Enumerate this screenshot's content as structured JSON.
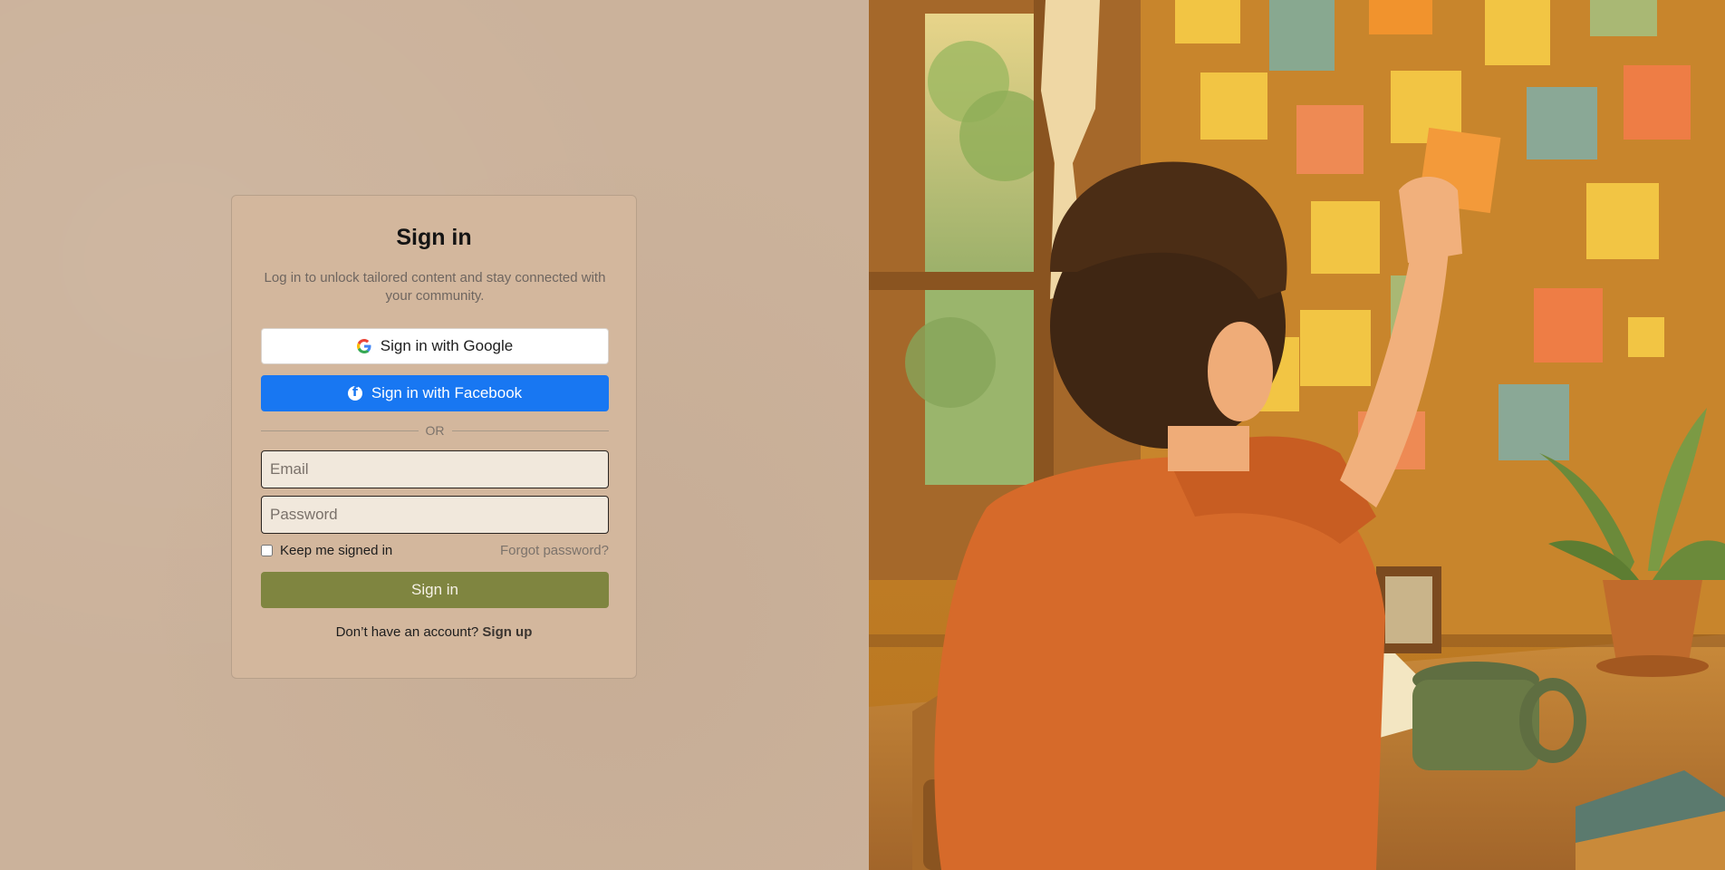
{
  "signin": {
    "title": "Sign in",
    "subtitle": "Log in to unlock tailored content and stay connected with your community.",
    "google_label": "Sign in with Google",
    "facebook_label": "Sign in with Facebook",
    "divider_text": "OR",
    "email_placeholder": "Email",
    "password_placeholder": "Password",
    "remember_label": "Keep me signed in",
    "forgot_label": "Forgot password?",
    "submit_label": "Sign in",
    "signup_prompt": "Don’t have an account?",
    "signup_link": "Sign up"
  },
  "colors": {
    "page_background": "#cbb29b",
    "card_background": "#d3b79d",
    "facebook_blue": "#1877f2",
    "signin_olive": "#7f8540"
  },
  "illustration": {
    "subject": "boy-pinning-sticky-notes-illustration"
  }
}
